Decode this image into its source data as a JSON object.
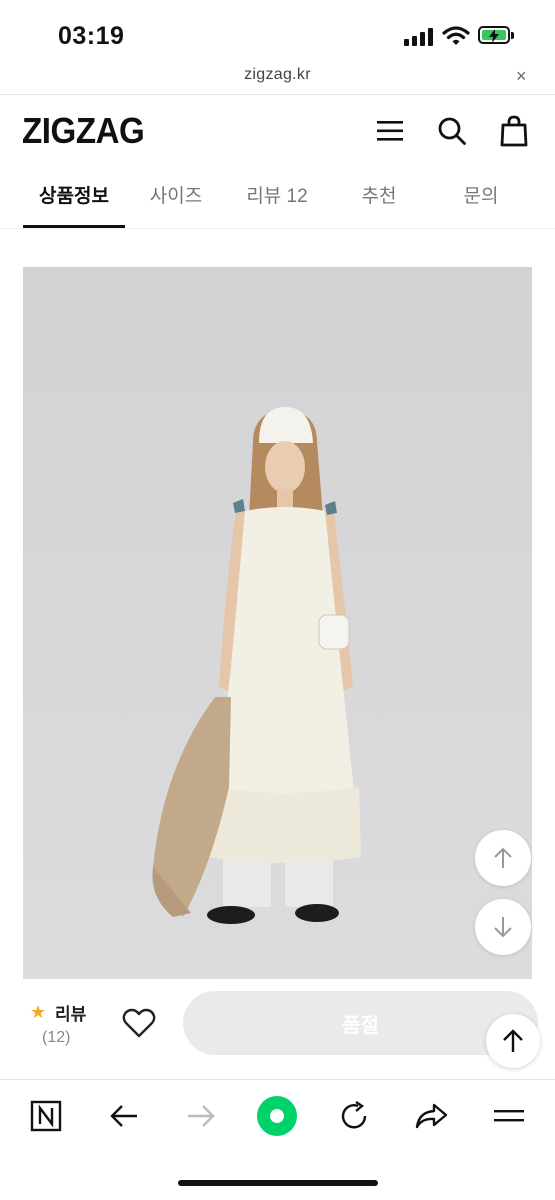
{
  "status_bar": {
    "time": "03:19"
  },
  "browser": {
    "url": "zigzag.kr",
    "close_symbol": "×"
  },
  "header": {
    "logo": "ZIGZAG",
    "icons": [
      "menu-icon",
      "search-icon",
      "shopping-bag-icon"
    ]
  },
  "tabs": [
    {
      "label": "상품정보",
      "active": true
    },
    {
      "label": "사이즈",
      "active": false
    },
    {
      "label": "리뷰 12",
      "active": false
    },
    {
      "label": "추천",
      "active": false
    },
    {
      "label": "문의",
      "active": false
    }
  ],
  "purchase_bar": {
    "review_label": "리뷰",
    "review_count": "(12)",
    "buy_button_label": "품절"
  },
  "colors": {
    "accent_green": "#00d26a",
    "star": "#f5a623",
    "image_bg": "#d6d6d8"
  },
  "toolbar_icons": [
    "naver-icon",
    "back-arrow-icon",
    "forward-arrow-icon",
    "green-dot-icon",
    "refresh-icon",
    "share-icon",
    "menu-lines-icon"
  ]
}
